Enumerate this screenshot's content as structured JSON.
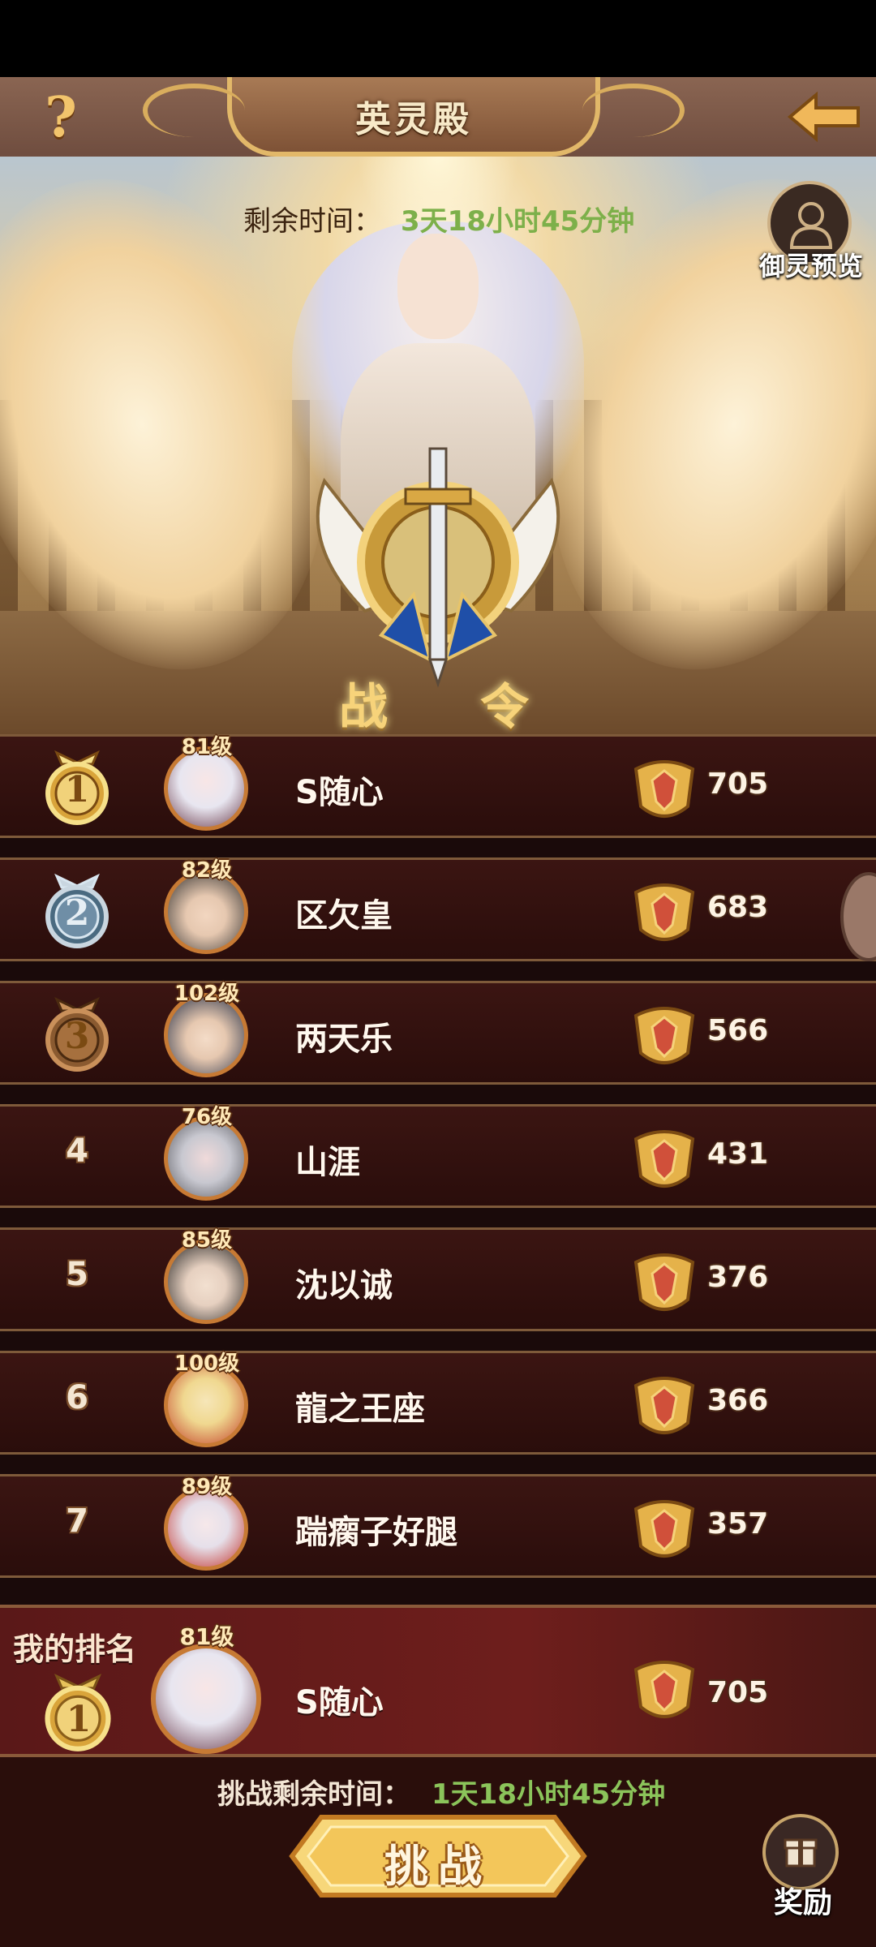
{
  "header": {
    "title": "英灵殿",
    "help_icon": "question-mark-icon",
    "back_icon": "back-arrow-icon"
  },
  "banner": {
    "timer_label": "剩余时间：",
    "timer_value": "3天18小时45分钟",
    "preview_label": "御灵预览",
    "emblem_left": "战",
    "emblem_right": "令"
  },
  "rankings": [
    {
      "rank": "1",
      "level": "81级",
      "name": "S随心",
      "score": "705",
      "medal": "gold"
    },
    {
      "rank": "2",
      "level": "82级",
      "name": "区欠皇",
      "score": "683",
      "medal": "silver"
    },
    {
      "rank": "3",
      "level": "102级",
      "name": "两天乐",
      "score": "566",
      "medal": "bronze"
    },
    {
      "rank": "4",
      "level": "76级",
      "name": "山涯",
      "score": "431",
      "medal": ""
    },
    {
      "rank": "5",
      "level": "85级",
      "name": "沈以诚",
      "score": "376",
      "medal": ""
    },
    {
      "rank": "6",
      "level": "100级",
      "name": "龍之王座",
      "score": "366",
      "medal": ""
    },
    {
      "rank": "7",
      "level": "89级",
      "name": "踹瘸子好腿",
      "score": "357",
      "medal": ""
    }
  ],
  "my_rank": {
    "label": "我的排名",
    "rank": "1",
    "level": "81级",
    "name": "S随心",
    "score": "705"
  },
  "bottom": {
    "challenge_timer_label": "挑战剩余时间：",
    "challenge_timer_value": "1天18小时45分钟",
    "challenge_label": "挑战",
    "reward_label": "奖励"
  },
  "colors": {
    "accent_gold": "#e2b869",
    "timer_green": "#7db04a",
    "row_bg": "#2a0d0b"
  }
}
